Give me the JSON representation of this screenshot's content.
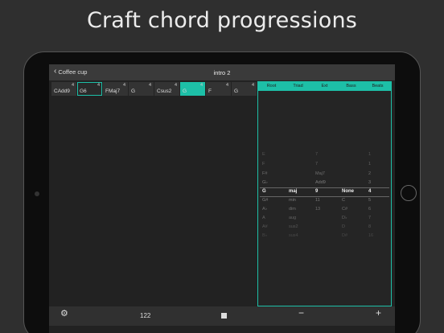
{
  "headline": "Craft chord progressions",
  "nav": {
    "back_label": "Coffee cup",
    "title": "intro 2"
  },
  "chords": [
    {
      "name": "CAdd9",
      "beats": "4",
      "state": ""
    },
    {
      "name": "G6",
      "beats": "4",
      "state": "sel"
    },
    {
      "name": "FMaj7",
      "beats": "4",
      "state": ""
    },
    {
      "name": "G",
      "beats": "4",
      "state": ""
    },
    {
      "name": "Csus2",
      "beats": "4",
      "state": ""
    },
    {
      "name": "G",
      "beats": "4",
      "state": "cur"
    },
    {
      "name": "F",
      "beats": "4",
      "state": ""
    },
    {
      "name": "G",
      "beats": "4",
      "state": ""
    }
  ],
  "picker": {
    "columns": [
      "Root",
      "Triad",
      "Ext",
      "Bass",
      "Beats"
    ],
    "rows": [
      [
        "E",
        "",
        "7",
        "",
        "1"
      ],
      [
        "F",
        "",
        "7",
        "",
        "1"
      ],
      [
        "F#",
        "",
        "Maj7",
        "",
        "2"
      ],
      [
        "G♭",
        "",
        "Add9",
        "",
        "3"
      ],
      [
        "G",
        "maj",
        "9",
        "None",
        "4"
      ],
      [
        "G#",
        "min",
        "11",
        "C",
        "5"
      ],
      [
        "A♭",
        "dim",
        "13",
        "C#",
        "6"
      ],
      [
        "A",
        "aug",
        "",
        "D♭",
        "7"
      ],
      [
        "A#",
        "sus2",
        "",
        "D",
        "8"
      ],
      [
        "B♭",
        "sus4",
        "",
        "D#",
        "16"
      ]
    ],
    "selected_index": 4
  },
  "toolbar": {
    "tempo": "122",
    "minus": "−",
    "plus": "+"
  }
}
